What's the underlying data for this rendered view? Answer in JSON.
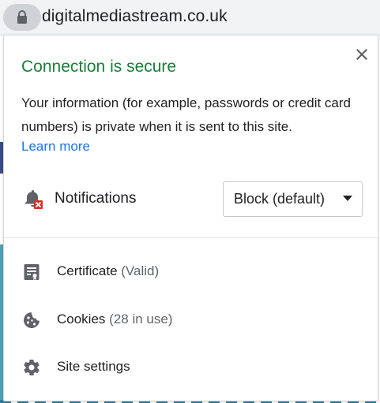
{
  "omnibox": {
    "url": "digitalmediastream.co.uk",
    "lock_icon": "lock-icon"
  },
  "popup": {
    "title": "Connection is secure",
    "description": "Your information (for example, passwords or credit card numbers) is private when it is sent to this site.",
    "learn_more": "Learn more",
    "close_icon": "close-icon",
    "title_color": "#188038",
    "link_color": "#1a73e8",
    "notifications": {
      "label": "Notifications",
      "icon": "notifications-blocked-icon",
      "value": "Block (default)"
    },
    "items": [
      {
        "label": "Certificate",
        "sub": "(Valid)",
        "icon": "certificate-icon"
      },
      {
        "label": "Cookies",
        "sub": "(28 in use)",
        "icon": "cookie-icon"
      },
      {
        "label": "Site settings",
        "sub": "",
        "icon": "gear-icon"
      }
    ]
  }
}
